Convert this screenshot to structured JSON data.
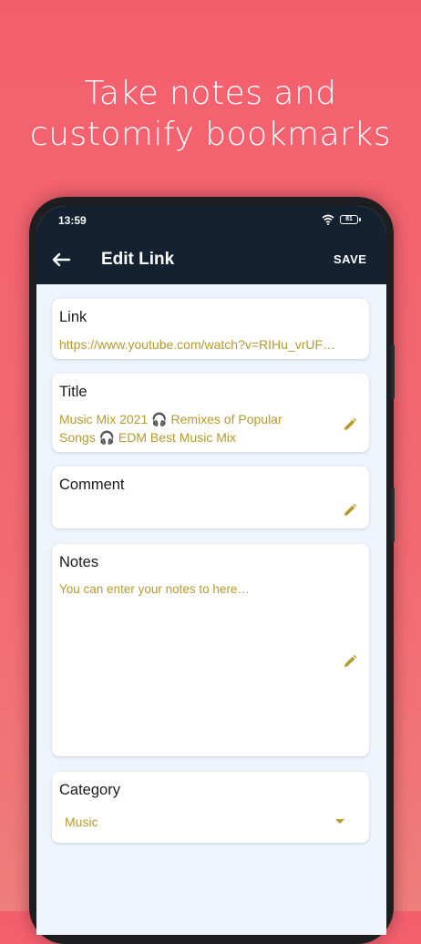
{
  "promo": {
    "headline_line1": "Take notes and",
    "headline_line2": "customify bookmarks"
  },
  "statusbar": {
    "time": "13:59",
    "battery": "81"
  },
  "appbar": {
    "title": "Edit Link",
    "save_label": "SAVE",
    "back_icon": "arrow-left-icon"
  },
  "form": {
    "link": {
      "label": "Link",
      "value": "https://www.youtube.com/watch?v=RIHu_vrUF…"
    },
    "title": {
      "label": "Title",
      "value_line1": "Music Mix 2021 🎧 Remixes of Popular",
      "value_line2": "Songs 🎧 EDM Best Music Mix"
    },
    "comment": {
      "label": "Comment",
      "value": ""
    },
    "notes": {
      "label": "Notes",
      "placeholder": "You can enter your notes to here…"
    },
    "category": {
      "label": "Category",
      "value": "Music"
    }
  },
  "colors": {
    "background": "#f45f6e",
    "appbar": "#132130",
    "accent_text": "#b79a2c",
    "screen_bg": "#eef4fb"
  }
}
